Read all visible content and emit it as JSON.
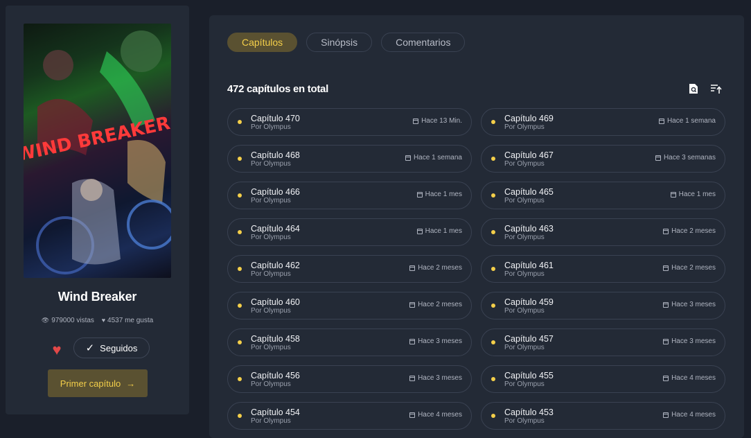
{
  "manga": {
    "title": "Wind Breaker",
    "views": "979000 vistas",
    "likes": "4537 me gusta",
    "follow_label": "Seguidos",
    "first_chapter_label": "Primer capítulo",
    "cover_text": "WIND BREAKER"
  },
  "tabs": [
    {
      "label": "Capítulos",
      "active": true
    },
    {
      "label": "Sinópsis",
      "active": false
    },
    {
      "label": "Comentarios",
      "active": false
    }
  ],
  "chapters_header": {
    "total": "472 capítulos en total",
    "icons": [
      "search-document-icon",
      "sort-icon"
    ]
  },
  "chapters": [
    {
      "name": "Capítulo 470",
      "by": "Por Olympus",
      "time": "Hace 13 Min."
    },
    {
      "name": "Capítulo 469",
      "by": "Por Olympus",
      "time": "Hace 1 semana"
    },
    {
      "name": "Capítulo 468",
      "by": "Por Olympus",
      "time": "Hace 1 semana"
    },
    {
      "name": "Capítulo 467",
      "by": "Por Olympus",
      "time": "Hace 3 semanas"
    },
    {
      "name": "Capítulo 466",
      "by": "Por Olympus",
      "time": "Hace 1 mes"
    },
    {
      "name": "Capítulo 465",
      "by": "Por Olympus",
      "time": "Hace 1 mes"
    },
    {
      "name": "Capítulo 464",
      "by": "Por Olympus",
      "time": "Hace 1 mes"
    },
    {
      "name": "Capítulo 463",
      "by": "Por Olympus",
      "time": "Hace 2 meses"
    },
    {
      "name": "Capítulo 462",
      "by": "Por Olympus",
      "time": "Hace 2 meses"
    },
    {
      "name": "Capítulo 461",
      "by": "Por Olympus",
      "time": "Hace 2 meses"
    },
    {
      "name": "Capítulo 460",
      "by": "Por Olympus",
      "time": "Hace 2 meses"
    },
    {
      "name": "Capítulo 459",
      "by": "Por Olympus",
      "time": "Hace 3 meses"
    },
    {
      "name": "Capítulo 458",
      "by": "Por Olympus",
      "time": "Hace 3 meses"
    },
    {
      "name": "Capítulo 457",
      "by": "Por Olympus",
      "time": "Hace 3 meses"
    },
    {
      "name": "Capítulo 456",
      "by": "Por Olympus",
      "time": "Hace 3 meses"
    },
    {
      "name": "Capítulo 455",
      "by": "Por Olympus",
      "time": "Hace 4 meses"
    },
    {
      "name": "Capítulo 454",
      "by": "Por Olympus",
      "time": "Hace 4 meses"
    },
    {
      "name": "Capítulo 453",
      "by": "Por Olympus",
      "time": "Hace 4 meses"
    }
  ],
  "colors": {
    "accent": "#f4cf4a",
    "accent_bg": "#5a5131",
    "panel": "#232a36",
    "page": "#1a1f2a",
    "heart": "#e24848"
  }
}
